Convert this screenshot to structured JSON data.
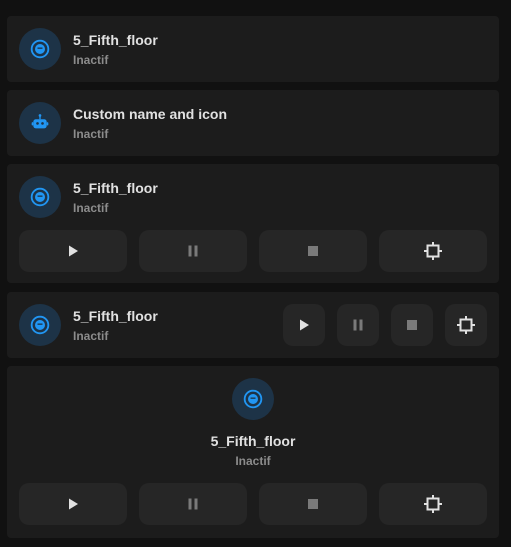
{
  "accent_color": "#2196f3",
  "icon_bg_color": "#1d3347",
  "cards": [
    {
      "name": "5_Fifth_floor",
      "state": "Inactif",
      "icon": "robot-vacuum-icon"
    },
    {
      "name": "Custom name and icon",
      "state": "Inactif",
      "icon": "robot-icon"
    },
    {
      "name": "5_Fifth_floor",
      "state": "Inactif",
      "icon": "robot-vacuum-icon",
      "buttons": [
        "play-icon",
        "pause-icon",
        "stop-icon",
        "locate-icon"
      ]
    },
    {
      "name": "5_Fifth_floor",
      "state": "Inactif",
      "icon": "robot-vacuum-icon",
      "buttons": [
        "play-icon",
        "pause-icon",
        "stop-icon",
        "locate-icon"
      ]
    },
    {
      "name": "5_Fifth_floor",
      "state": "Inactif",
      "icon": "robot-vacuum-icon",
      "buttons": [
        "play-icon",
        "pause-icon",
        "stop-icon",
        "locate-icon"
      ]
    }
  ]
}
